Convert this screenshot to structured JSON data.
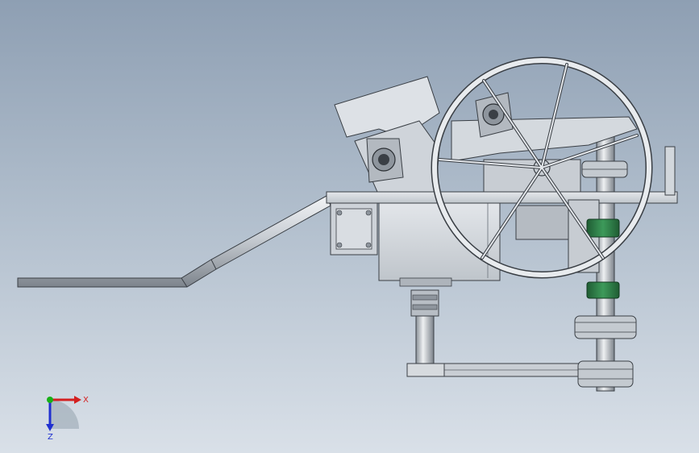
{
  "triad": {
    "x_label": "X",
    "z_label": "Z",
    "x_color": "#d42020",
    "y_color": "#18b018",
    "z_color": "#2030d0"
  },
  "colors": {
    "metal_light": "#dfe3e8",
    "metal_mid": "#bcc2c9",
    "metal_dark": "#8e959d",
    "outline": "#3a3f45",
    "green_part": "#2d7a45"
  }
}
